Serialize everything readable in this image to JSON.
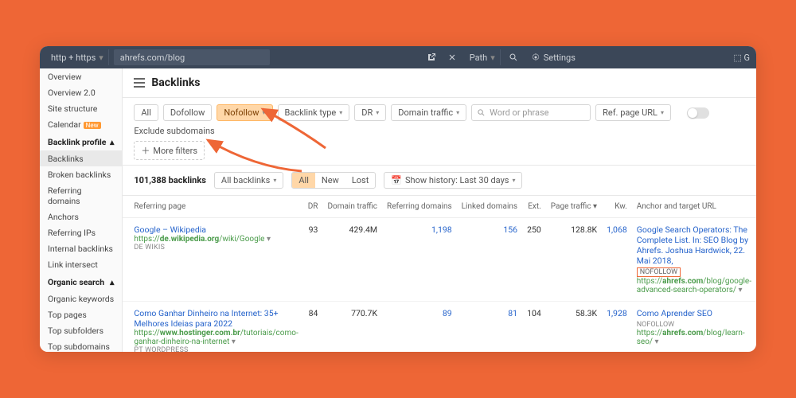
{
  "topbar": {
    "protocol": "http + https",
    "url": "ahrefs.com/blog",
    "path": "Path",
    "settings": "Settings",
    "right": "G"
  },
  "sidebar": {
    "items1": [
      "Overview",
      "Overview 2.0",
      "Site structure"
    ],
    "calendar": "Calendar",
    "calendar_tag": "New",
    "group1": "Backlink profile",
    "items2": [
      "Backlinks",
      "Broken backlinks",
      "Referring domains",
      "Anchors",
      "Referring IPs",
      "Internal backlinks",
      "Link intersect"
    ],
    "group2": "Organic search",
    "items3": [
      "Organic keywords",
      "Top pages",
      "Top subfolders",
      "Top subdomains"
    ]
  },
  "title": "Backlinks",
  "filters": {
    "all": "All",
    "dofollow": "Dofollow",
    "nofollow": "Nofollow",
    "btype": "Backlink type",
    "dr": "DR",
    "dt": "Domain traffic",
    "search_ph": "Word or phrase",
    "ref": "Ref. page URL",
    "exclude": "Exclude subdomains",
    "more": "More filters"
  },
  "subbar": {
    "count": "101,388 backlinks",
    "allbl": "All backlinks",
    "tabs": [
      "All",
      "New",
      "Lost"
    ],
    "history": "Show history: Last 30 days"
  },
  "columns": [
    "Referring page",
    "DR",
    "Domain traffic",
    "Referring domains",
    "Linked domains",
    "Ext.",
    "Page traffic",
    "Kw.",
    "Anchor and target URL"
  ],
  "rows": [
    {
      "title": "Google – Wikipedia",
      "url_pre": "https://",
      "url_bold": "de.wikipedia.org",
      "url_rest": "/wiki/Google",
      "tags": "DE  WIKIS",
      "dr": "93",
      "dt": "429.4M",
      "rd": "1,198",
      "ld": "156",
      "ext": "250",
      "pt": "128.8K",
      "kw": "1,068",
      "anchor": "Google Search Operators: The Complete List. In: SEO Blog by Ahrefs. Joshua Hardwick, 22. Mai 2018,",
      "nf": "NOFOLLOW",
      "target_pre": "https://",
      "target_bold": "ahrefs.com",
      "target_rest": "/blog/google-advanced-search-operators/"
    },
    {
      "title": "Como Ganhar Dinheiro na Internet: 35+ Melhores Ideias para 2022",
      "url_pre": "https://",
      "url_bold": "www.hostinger.com.br",
      "url_rest": "/tutoriais/como-ganhar-dinheiro-na-internet",
      "tags": "PT  WORDPRESS",
      "dr": "84",
      "dt": "770.7K",
      "rd": "89",
      "ld": "81",
      "ext": "104",
      "pt": "58.3K",
      "kw": "1,928",
      "anchor": "Como Aprender SEO",
      "nf": "NOFOLLOW",
      "target_pre": "https://",
      "target_bold": "ahrefs.com",
      "target_rest": "/blog/learn-seo/"
    }
  ]
}
